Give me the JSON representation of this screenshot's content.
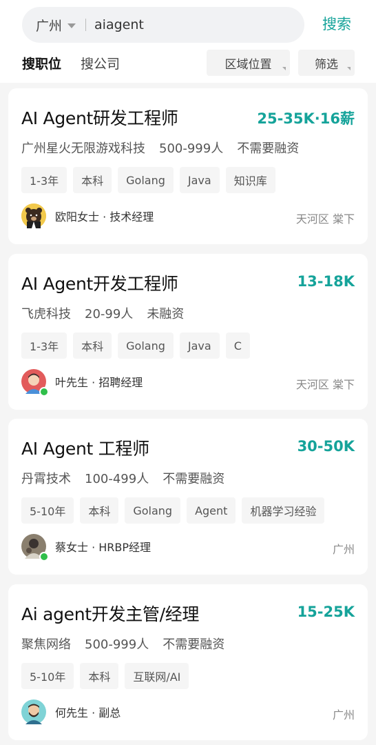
{
  "search": {
    "city": "广州",
    "query": "aiagent",
    "button_label": "搜索"
  },
  "tabs": {
    "positions": "搜职位",
    "companies": "搜公司"
  },
  "filters": {
    "area": "区域位置",
    "filter": "筛选"
  },
  "jobs": [
    {
      "title": "AI Agent研发工程师",
      "salary": "25-35K·16薪",
      "company": "广州星火无限游戏科技",
      "size": "500-999人",
      "funding": "不需要融资",
      "tags": [
        "1-3年",
        "本科",
        "Golang",
        "Java",
        "知识库"
      ],
      "recruiter": "欧阳女士 · 技术经理",
      "location": "天河区 棠下",
      "avatar_icon": "bear-avatar-icon"
    },
    {
      "title": "AI Agent开发工程师",
      "salary": "13-18K",
      "company": "飞虎科技",
      "size": "20-99人",
      "funding": "未融资",
      "tags": [
        "1-3年",
        "本科",
        "Golang",
        "Java",
        "C"
      ],
      "recruiter": "叶先生 · 招聘经理",
      "location": "天河区 棠下",
      "avatar_icon": "person-avatar-icon"
    },
    {
      "title": "AI Agent 工程师",
      "salary": "30-50K",
      "company": "丹霄技术",
      "size": "100-499人",
      "funding": "不需要融资",
      "tags": [
        "5-10年",
        "本科",
        "Golang",
        "Agent",
        "机器学习经验"
      ],
      "recruiter": "蔡女士 · HRBP经理",
      "location": "广州",
      "avatar_icon": "photo-avatar-icon"
    },
    {
      "title": "Ai agent开发主管/经理",
      "salary": "15-25K",
      "company": "聚焦网络",
      "size": "500-999人",
      "funding": "不需要融资",
      "tags": [
        "5-10年",
        "本科",
        "互联网/AI"
      ],
      "recruiter": "何先生 · 副总",
      "location": "广州",
      "avatar_icon": "bearded-avatar-icon"
    }
  ],
  "colors": {
    "accent": "#15a39a",
    "online": "#2fbf4a"
  }
}
